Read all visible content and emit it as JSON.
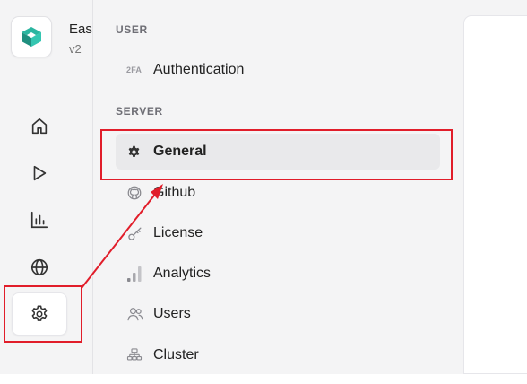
{
  "app": {
    "name": "Easy",
    "version": "v2"
  },
  "rail": {
    "items": [
      {
        "key": "home",
        "icon": "home-icon"
      },
      {
        "key": "play",
        "icon": "play-icon"
      },
      {
        "key": "analytics",
        "icon": "bar-chart-icon"
      },
      {
        "key": "globe",
        "icon": "globe-icon"
      },
      {
        "key": "settings",
        "icon": "gear-icon",
        "active": true
      }
    ]
  },
  "menu": {
    "sections": [
      {
        "label": "USER",
        "items": [
          {
            "label": "Authentication",
            "icon": "2fa-icon",
            "badge": "2FA"
          }
        ]
      },
      {
        "label": "SERVER",
        "items": [
          {
            "label": "General",
            "icon": "gear-icon",
            "active": true
          },
          {
            "label": "Github",
            "icon": "github-icon"
          },
          {
            "label": "License",
            "icon": "key-icon"
          },
          {
            "label": "Analytics",
            "icon": "signal-bars-icon"
          },
          {
            "label": "Users",
            "icon": "users-icon"
          },
          {
            "label": "Cluster",
            "icon": "cluster-icon"
          }
        ]
      }
    ]
  },
  "annotation": {
    "color": "#e11d2a"
  }
}
